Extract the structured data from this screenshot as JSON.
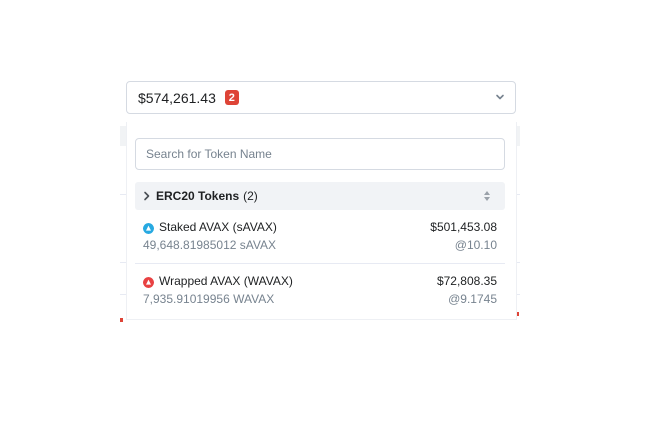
{
  "selector": {
    "value": "$574,261.43",
    "badge": "2"
  },
  "search": {
    "placeholder": "Search for Token Name"
  },
  "group": {
    "title": "ERC20 Tokens",
    "count": "(2)"
  },
  "tokens": [
    {
      "name": "Staked AVAX (sAVAX)",
      "usd": "$501,453.08",
      "quantity": "49,648.81985012 sAVAX",
      "price": "@10.10",
      "icon": "savax-token-icon",
      "icon_color": "#27a9e1"
    },
    {
      "name": "Wrapped AVAX (WAVAX)",
      "usd": "$72,808.35",
      "quantity": "7,935.91019956 WAVAX",
      "price": "@9.1745",
      "icon": "avax-token-icon",
      "icon_color": "#e84142"
    }
  ],
  "colors": {
    "badge": "#de4437",
    "muted_text": "#77838f",
    "group_bg": "#f1f3f6"
  }
}
